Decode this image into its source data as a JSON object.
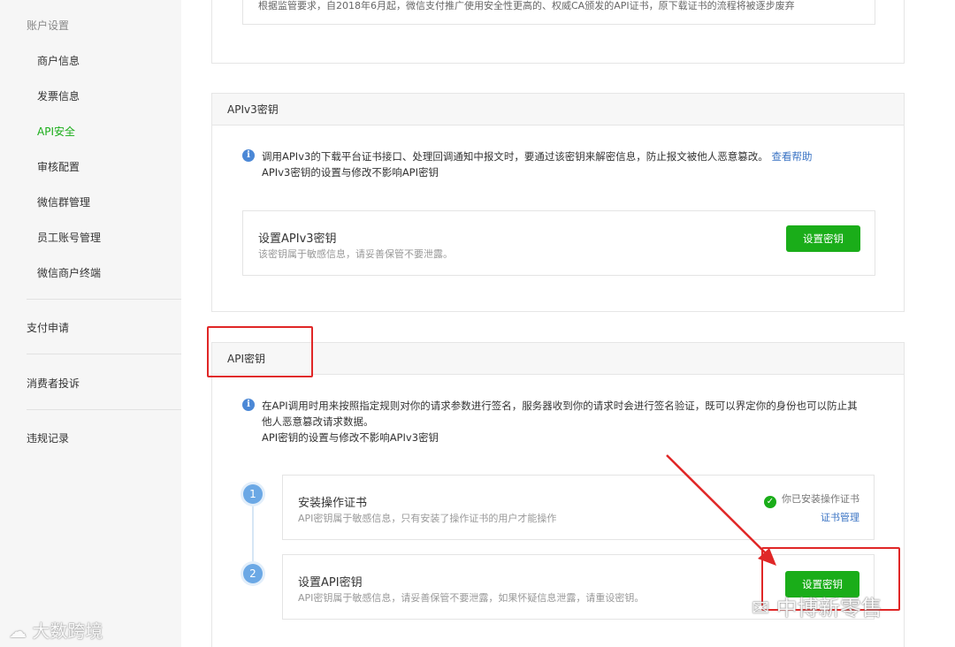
{
  "sidebar": {
    "group_title": "账户设置",
    "items": [
      {
        "label": "商户信息"
      },
      {
        "label": "发票信息"
      },
      {
        "label": "API安全"
      },
      {
        "label": "审核配置"
      },
      {
        "label": "微信群管理"
      },
      {
        "label": "员工账号管理"
      },
      {
        "label": "微信商户终端"
      }
    ],
    "sections": [
      {
        "label": "支付申请"
      },
      {
        "label": "消费者投诉"
      },
      {
        "label": "违规记录"
      }
    ]
  },
  "top_card": {
    "notice_partial": "根据监管要求，自2018年6月起，微信支付推广使用安全性更高的、权威CA颁发的API证书，原下载证书的流程将被逐步废弃"
  },
  "apiv3_card": {
    "header": "APIv3密钥",
    "notice_line1": "调用APIv3的下载平台证书接口、处理回调通知中报文时，要通过该密钥来解密信息，防止报文被他人恶意篡改。",
    "notice_link": "查看帮助",
    "notice_line2": "APIv3密钥的设置与修改不影响API密钥",
    "box_title": "设置APIv3密钥",
    "box_desc": "该密钥属于敏感信息，请妥善保管不要泄露。",
    "button": "设置密钥"
  },
  "api_card": {
    "header": "API密钥",
    "notice_line1": "在API调用时用来按照指定规则对你的请求参数进行签名，服务器收到你的请求时会进行签名验证，既可以界定你的身份也可以防止其",
    "notice_line2": "他人恶意篡改请求数据。",
    "notice_line3": "API密钥的设置与修改不影响APIv3密钥",
    "step1": {
      "number": "1",
      "title": "安装操作证书",
      "desc": "API密钥属于敏感信息，只有安装了操作证书的用户才能操作",
      "status": "你已安装操作证书",
      "link": "证书管理"
    },
    "step2": {
      "number": "2",
      "title": "设置API密钥",
      "desc": "API密钥属于敏感信息，请妥善保管不要泄露，如果怀疑信息泄露，请重设密钥。",
      "button": "设置密钥"
    }
  },
  "watermarks": {
    "left": "大数跨境",
    "right": "中博新零售"
  },
  "colors": {
    "accent_green": "#1aad19",
    "link_blue": "#3b74c4",
    "highlight_red": "#e02727"
  }
}
